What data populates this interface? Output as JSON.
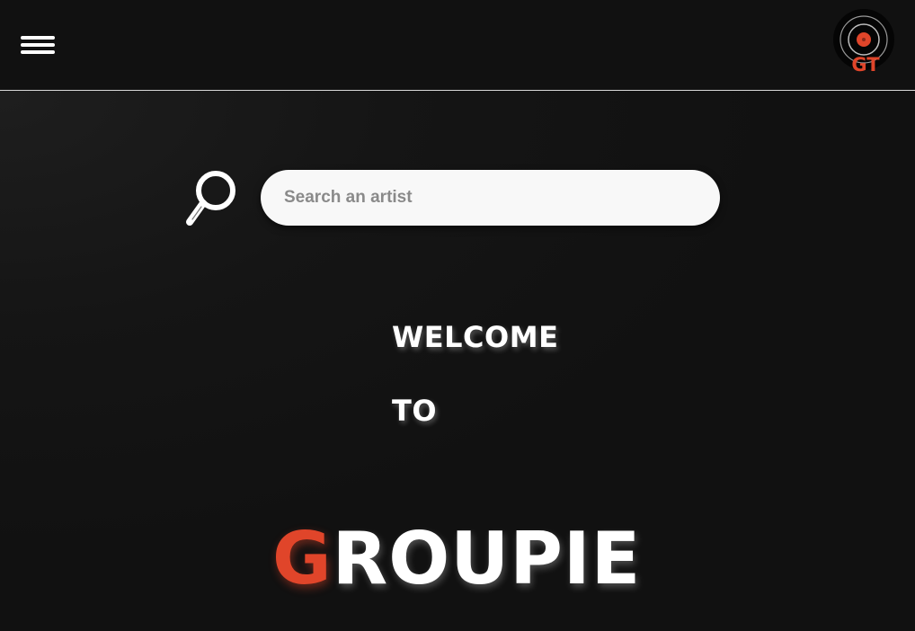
{
  "header": {
    "menu_icon": "hamburger-menu-icon",
    "logo_text": "GT",
    "logo_icon": "vinyl-record-icon"
  },
  "search": {
    "icon": "magnifying-glass-icon",
    "placeholder": "Search an artist",
    "value": ""
  },
  "hero": {
    "line1": "WELCOME",
    "line2": "TO",
    "brand_first": "G",
    "brand_rest": "ROUPIE"
  },
  "colors": {
    "background": "#111111",
    "accent": "#e0452a",
    "text": "#ffffff",
    "input_bg": "#f8f8f8",
    "divider": "#d8d8d8"
  }
}
